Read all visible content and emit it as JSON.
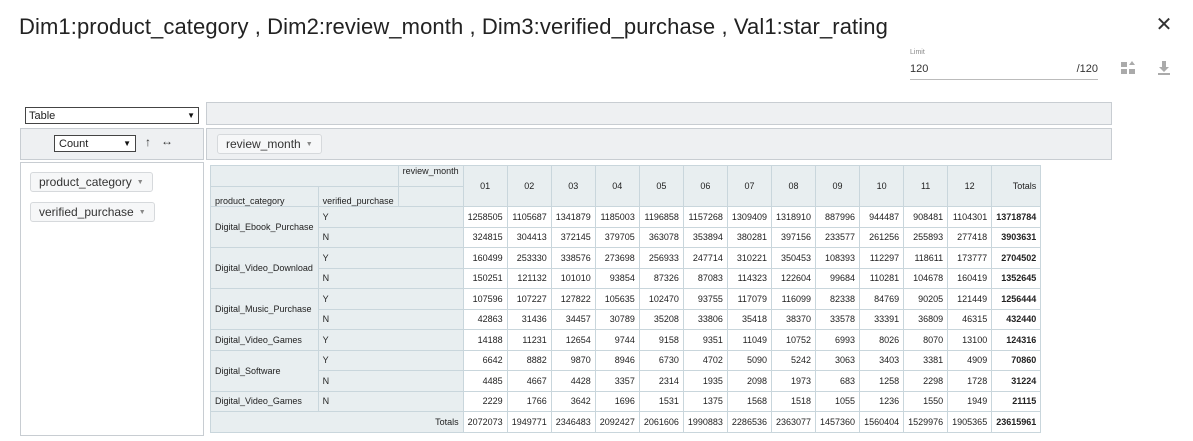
{
  "title": "Dim1:product_category , Dim2:review_month , Dim3:verified_purchase , Val1:star_rating",
  "close_icon": "close-icon",
  "limit": {
    "label": "Limit",
    "value": "120",
    "max": "/120"
  },
  "toolbar": {
    "switch_icon": "swap-axes-icon",
    "download_icon": "download-icon"
  },
  "renderer": {
    "selected": "Table"
  },
  "aggregator": {
    "selected": "Count",
    "sort_glyph": "↑",
    "swap_glyph": "↔"
  },
  "column_fields": [
    {
      "label": "review_month"
    }
  ],
  "row_fields": [
    {
      "label": "product_category"
    },
    {
      "label": "verified_purchase"
    }
  ],
  "table": {
    "col_attr": "review_month",
    "row_attrs": [
      "product_category",
      "verified_purchase"
    ],
    "col_headers": [
      "01",
      "02",
      "03",
      "04",
      "05",
      "06",
      "07",
      "08",
      "09",
      "10",
      "11",
      "12"
    ],
    "totals_label": "Totals",
    "groups": [
      {
        "category": "Digital_Ebook_Purchase",
        "rows": [
          {
            "vp": "Y",
            "values": [
              "1258505",
              "1105687",
              "1341879",
              "1185003",
              "1196858",
              "1157268",
              "1309409",
              "1318910",
              "887996",
              "944487",
              "908481",
              "1104301"
            ],
            "total": "13718784"
          },
          {
            "vp": "N",
            "values": [
              "324815",
              "304413",
              "372145",
              "379705",
              "363078",
              "353894",
              "380281",
              "397156",
              "233577",
              "261256",
              "255893",
              "277418"
            ],
            "total": "3903631"
          }
        ]
      },
      {
        "category": "Digital_Video_Download",
        "rows": [
          {
            "vp": "Y",
            "values": [
              "160499",
              "253330",
              "338576",
              "273698",
              "256933",
              "247714",
              "310221",
              "350453",
              "108393",
              "112297",
              "118611",
              "173777"
            ],
            "total": "2704502"
          },
          {
            "vp": "N",
            "values": [
              "150251",
              "121132",
              "101010",
              "93854",
              "87326",
              "87083",
              "114323",
              "122604",
              "99684",
              "110281",
              "104678",
              "160419"
            ],
            "total": "1352645"
          }
        ]
      },
      {
        "category": "Digital_Music_Purchase",
        "rows": [
          {
            "vp": "Y",
            "values": [
              "107596",
              "107227",
              "127822",
              "105635",
              "102470",
              "93755",
              "117079",
              "116099",
              "82338",
              "84769",
              "90205",
              "121449"
            ],
            "total": "1256444"
          },
          {
            "vp": "N",
            "values": [
              "42863",
              "31436",
              "34457",
              "30789",
              "35208",
              "33806",
              "35418",
              "38370",
              "33578",
              "33391",
              "36809",
              "46315"
            ],
            "total": "432440"
          }
        ]
      },
      {
        "category": "Digital_Video_Games",
        "rows": [
          {
            "vp": "Y",
            "values": [
              "14188",
              "11231",
              "12654",
              "9744",
              "9158",
              "9351",
              "11049",
              "10752",
              "6993",
              "8026",
              "8070",
              "13100"
            ],
            "total": "124316"
          }
        ]
      },
      {
        "category": "Digital_Software",
        "rows": [
          {
            "vp": "Y",
            "values": [
              "6642",
              "8882",
              "9870",
              "8946",
              "6730",
              "4702",
              "5090",
              "5242",
              "3063",
              "3403",
              "3381",
              "4909"
            ],
            "total": "70860"
          },
          {
            "vp": "N",
            "values": [
              "4485",
              "4667",
              "4428",
              "3357",
              "2314",
              "1935",
              "2098",
              "1973",
              "683",
              "1258",
              "2298",
              "1728"
            ],
            "total": "31224"
          }
        ]
      },
      {
        "category": "Digital_Video_Games",
        "rows": [
          {
            "vp": "N",
            "values": [
              "2229",
              "1766",
              "3642",
              "1696",
              "1531",
              "1375",
              "1568",
              "1518",
              "1055",
              "1236",
              "1550",
              "1949"
            ],
            "total": "21115"
          }
        ]
      }
    ],
    "col_totals": [
      "2072073",
      "1949771",
      "2346483",
      "2092427",
      "2061606",
      "1990883",
      "2286536",
      "2363077",
      "1457360",
      "1560404",
      "1529976",
      "1905365"
    ],
    "grand_total": "23615961"
  }
}
